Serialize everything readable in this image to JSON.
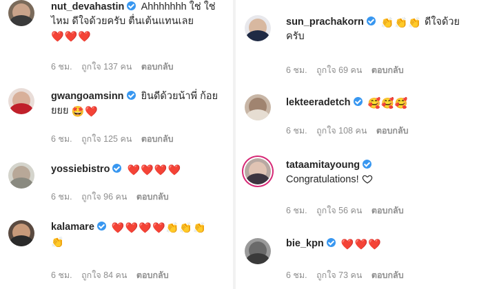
{
  "left": [
    {
      "username": "nut_devahastin",
      "text": "Ahhhhhhh ใช่ ใช่ไหม ดีใจด้วยครับ ตื่นเต้นแทนเลย",
      "emojis": [
        "❤️",
        "❤️",
        "❤️"
      ],
      "time": "6 ชม.",
      "likes": "ถูกใจ 137 คน",
      "reply": "ตอบกลับ"
    },
    {
      "username": "gwangoamsinn",
      "text": "ยินดีด้วยน้าพี่ ก้อยยยย",
      "emojis": [
        "🤩",
        "❤️"
      ],
      "time": "6 ชม.",
      "likes": "ถูกใจ 125 คน",
      "reply": "ตอบกลับ"
    },
    {
      "username": "yossiebistro",
      "text": "",
      "emojis": [
        "❤️",
        "❤️",
        "❤️",
        "❤️"
      ],
      "time": "6 ชม.",
      "likes": "ถูกใจ 96 คน",
      "reply": "ตอบกลับ"
    },
    {
      "username": "kalamare",
      "text": "",
      "emojis": [
        "❤️",
        "❤️",
        "❤️",
        "❤️",
        "👏",
        "👏",
        "👏",
        "👏"
      ],
      "time": "6 ชม.",
      "likes": "ถูกใจ 84 คน",
      "reply": "ตอบกลับ"
    }
  ],
  "right": [
    {
      "username": "sun_prachakorn",
      "text": "ดีใจด้วยครับ",
      "emojis": [
        "👏",
        "👏",
        "👏"
      ],
      "time": "6 ชม.",
      "likes": "ถูกใจ 69 คน",
      "reply": "ตอบกลับ"
    },
    {
      "username": "lekteeradetch",
      "text": "",
      "emojis": [
        "🥰",
        "🥰",
        "🥰"
      ],
      "time": "6 ชม.",
      "likes": "ถูกใจ 108 คน",
      "reply": "ตอบกลับ"
    },
    {
      "username": "tataamitayoung",
      "text": "Congratulations!",
      "emojis": [],
      "time": "6 ชม.",
      "likes": "ถูกใจ 56 คน",
      "reply": "ตอบกลับ"
    },
    {
      "username": "bie_kpn",
      "text": "",
      "emojis": [
        "❤️",
        "❤️",
        "❤️"
      ],
      "time": "6 ชม.",
      "likes": "ถูกใจ 73 คน",
      "reply": "ตอบกลับ"
    }
  ]
}
